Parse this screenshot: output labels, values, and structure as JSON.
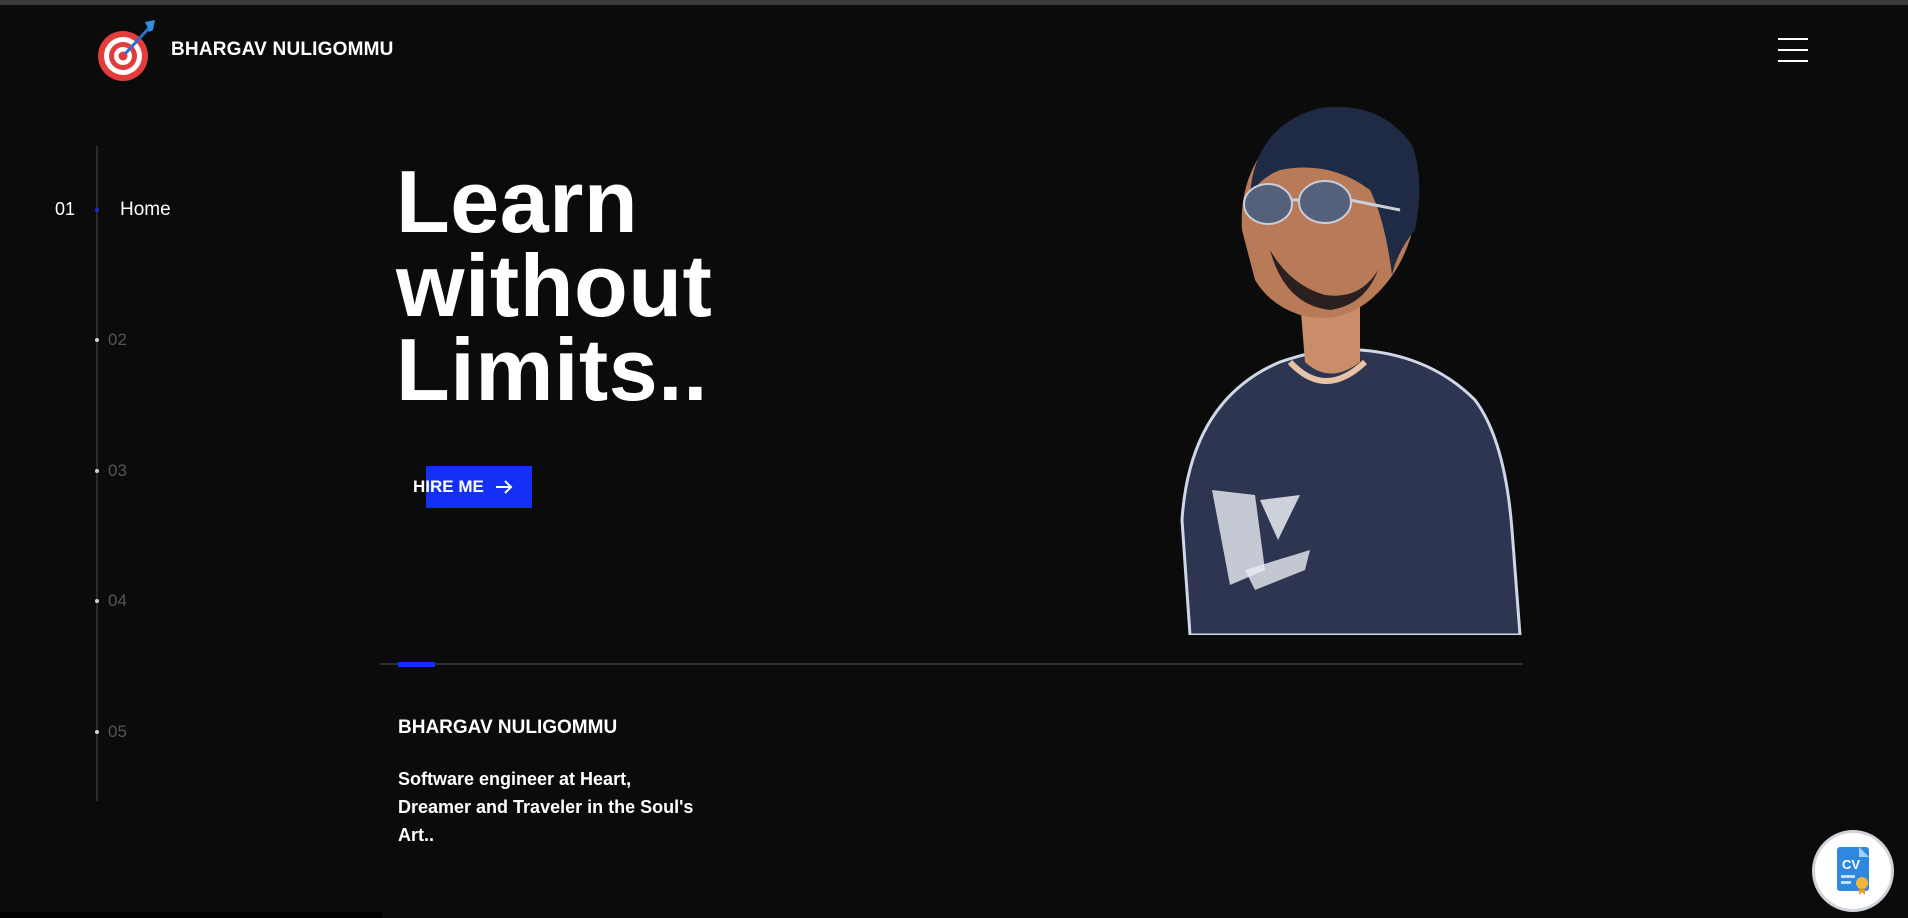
{
  "header": {
    "brand_name": "BHARGAV NULIGOMMU",
    "logo_icon": "target-dart-icon",
    "menu_icon": "hamburger-menu-icon"
  },
  "sidebar": {
    "active": {
      "number": "01",
      "label": "Home"
    },
    "items": [
      {
        "number": "02"
      },
      {
        "number": "03"
      },
      {
        "number": "04"
      },
      {
        "number": "05"
      }
    ]
  },
  "hero": {
    "headline_lines": [
      "Learn",
      "without",
      "Limits.."
    ],
    "cta_label": "HIRE ME",
    "cta_icon": "arrow-right-icon"
  },
  "progress": {
    "value_fraction": 0.04
  },
  "about": {
    "name": "BHARGAV NULIGOMMU",
    "description": "Software engineer at Heart, Dreamer and Traveler in the Soul's Art.."
  },
  "floating": {
    "cv_label": "CV",
    "cv_icon": "cv-document-icon"
  },
  "colors": {
    "background": "#0b0b0c",
    "accent": "#1530f5",
    "text": "#ffffff",
    "muted": "#55565c"
  }
}
